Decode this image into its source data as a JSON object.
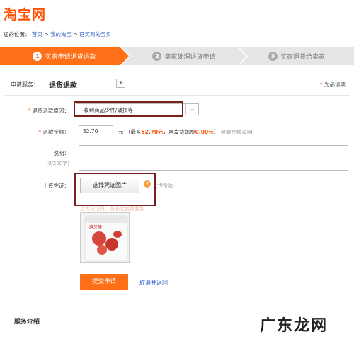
{
  "header": {
    "logo": "淘宝网"
  },
  "breadcrumb": {
    "prefix": "您的位置：",
    "items": [
      "首页",
      "我的淘宝",
      "已买到的宝贝"
    ],
    "sep": ">"
  },
  "steps": [
    {
      "num": "1",
      "label": "买家申请退货退款"
    },
    {
      "num": "2",
      "label": "卖家处理退货申请"
    },
    {
      "num": "3",
      "label": "买家退货给卖家"
    }
  ],
  "form": {
    "service_label": "申请服务：",
    "service_value": "退货退款",
    "required_note": "为必填项",
    "reason_label": "退货退款原因：",
    "reason_value": "收到商品少件/破损等",
    "amount_label": "退款金额：",
    "amount_value": "52.70",
    "amount_unit": "元",
    "amount_max_prefix": "（最多",
    "amount_max": "52.70元",
    "amount_mid": "，含发货邮费",
    "amount_shipping": "0.00元",
    "amount_suffix": "）",
    "amount_help": "退款金额说明",
    "desc_label": "说明：",
    "desc_count": "(0/200字)",
    "upload_label": "上传凭证：",
    "upload_button": "选择凭证图片",
    "upload_help": "上传帮助",
    "upload_hint": "上传凭证时，务必让卖家看到",
    "thumb_text": "磨牙棒",
    "submit": "提交申请",
    "cancel": "取消并返回"
  },
  "service_intro": {
    "title": "服务介绍"
  },
  "watermark": "广东龙网",
  "colors": {
    "accent": "#ff6f17",
    "link": "#3366cc",
    "highlight_box": "#7a1f1f"
  }
}
